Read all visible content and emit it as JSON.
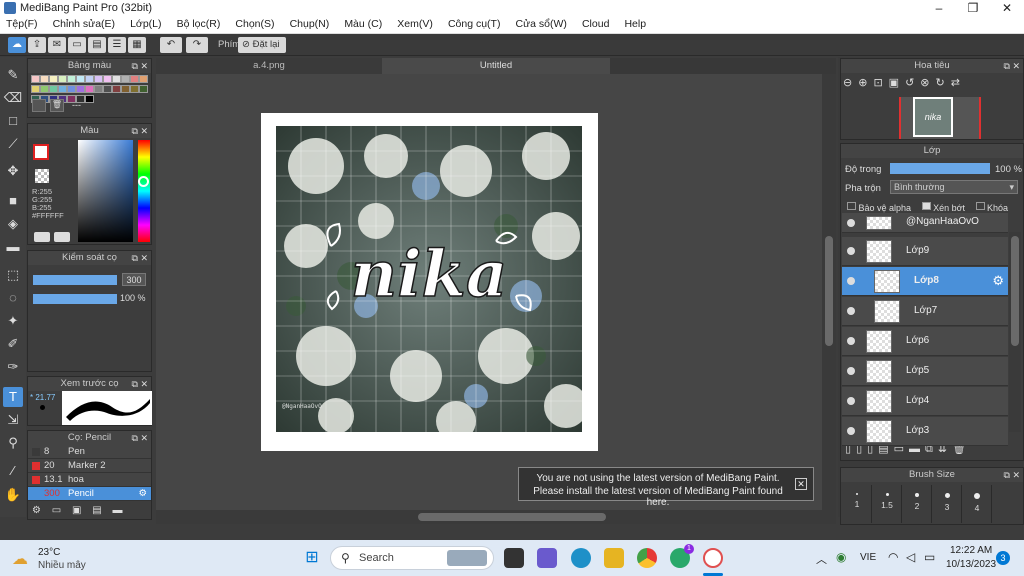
{
  "window": {
    "title": "MediBang Paint Pro (32bit)",
    "controls": [
      "–",
      "❐",
      "✕"
    ]
  },
  "menu": [
    "Tệp(F)",
    "Chỉnh sửa(E)",
    "Lớp(L)",
    "Bộ lọc(R)",
    "Chọn(S)",
    "Chụp(N)",
    "Màu (C)",
    "Xem(V)",
    "Công cụ(T)",
    "Cửa sổ(W)",
    "Cloud",
    "Help"
  ],
  "toolbar": {
    "phim_label": "Phím",
    "reset_label": "Đặt lại"
  },
  "palette_panel": {
    "title": "Bảng màu",
    "list_label": "---",
    "swatches": [
      "#f5c6c6",
      "#f7dcc0",
      "#f5f0c0",
      "#d8f0c0",
      "#c0f0d8",
      "#c0e8f5",
      "#c0d0f5",
      "#d8c0f5",
      "#f0c0f0",
      "#e0e0e0",
      "#b0b0b0",
      "#e08080",
      "#e0a070",
      "#e0d070",
      "#90c870",
      "#70c8a0",
      "#70b0e0",
      "#7090e0",
      "#a070e0",
      "#e070c0",
      "#808080",
      "#505050",
      "#804040",
      "#806030",
      "#807030",
      "#406030",
      "#306050",
      "#305080",
      "#303080",
      "#503080",
      "#803060",
      "#303030",
      "#000000"
    ]
  },
  "color_panel": {
    "title": "Màu",
    "r": "R:255",
    "g": "G:255",
    "b": "B:255",
    "hex": "#FFFFFF",
    "fg_color": "#ffffff",
    "accent": "#3a7bd5"
  },
  "brush_control": {
    "title": "Kiểm soát cọ",
    "size_value": "300",
    "opacity_value": "100 %",
    "size_fill": 0.85,
    "opacity_fill": 0.85
  },
  "brush_preview": {
    "title": "Xem trước cọ",
    "size_text": "* 21.77"
  },
  "brush_list": {
    "title": "Cọ: Pencil",
    "items": [
      {
        "size": "8",
        "name": "Pen",
        "color": "#3a3a3a",
        "selected": false
      },
      {
        "size": "20",
        "name": "Marker 2",
        "color": "#e03030",
        "selected": false
      },
      {
        "size": "13.1",
        "name": "hoa",
        "color": "#e03030",
        "selected": false
      },
      {
        "size": "300",
        "name": "Pencil",
        "color": "#4a90d9",
        "selected": true
      }
    ]
  },
  "tabs": [
    {
      "label": "a.4.png",
      "active": false
    },
    {
      "label": "Untitled",
      "active": true
    }
  ],
  "artwork": {
    "title_text": "nika",
    "watermark": "@NganHaaOvO"
  },
  "navigator": {
    "title": "Hoa tiêu"
  },
  "layers_panel": {
    "title": "Lớp",
    "opacity_label": "Độ trong",
    "opacity_value": "100 %",
    "blend_label": "Pha trộn",
    "blend_value": "Bình thường",
    "protect_alpha": "Bảo vệ alpha",
    "clipping": "Xén bớt",
    "lock": "Khóa",
    "layers": [
      {
        "name": "@NganHaaOvO",
        "selected": false,
        "indent": false
      },
      {
        "name": "Lớp9",
        "selected": false,
        "indent": false
      },
      {
        "name": "Lớp8",
        "selected": true,
        "indent": true
      },
      {
        "name": "Lớp7",
        "selected": false,
        "indent": true
      },
      {
        "name": "Lớp6",
        "selected": false,
        "indent": false
      },
      {
        "name": "Lớp5",
        "selected": false,
        "indent": false
      },
      {
        "name": "Lớp4",
        "selected": false,
        "indent": false
      },
      {
        "name": "Lớp3",
        "selected": false,
        "indent": false
      }
    ]
  },
  "brush_size_panel": {
    "title": "Brush Size",
    "sizes": [
      "1",
      "1.5",
      "2",
      "3",
      "4"
    ]
  },
  "notification": {
    "line1": "You are not using the latest version of MediBang Paint.",
    "line2": "Please install the latest version of MediBang Paint found here."
  },
  "taskbar": {
    "weather_temp": "23°C",
    "weather_desc": "Nhiều mây",
    "search_placeholder": "Search",
    "language": "VIE",
    "time": "12:22 AM",
    "date": "10/13/2023",
    "notification_count": "3",
    "chat_badge": "1"
  }
}
